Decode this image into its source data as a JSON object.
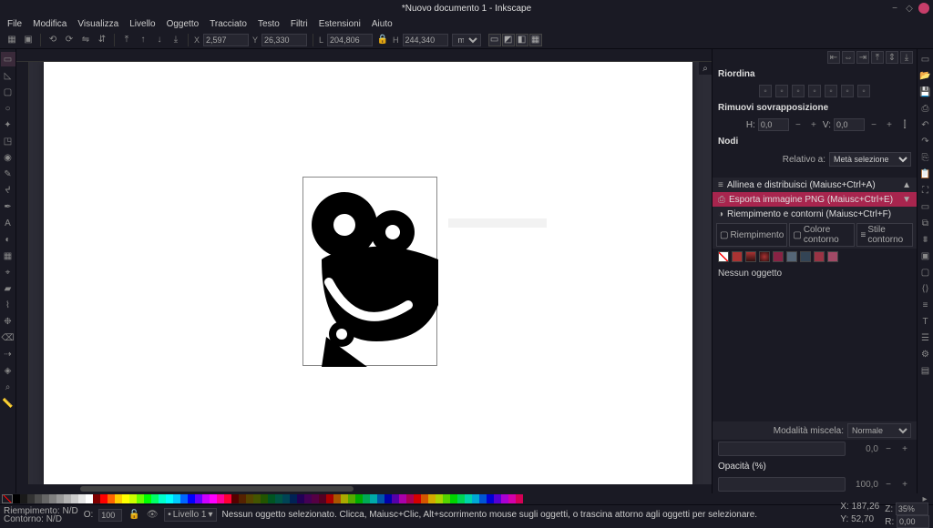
{
  "title": "*Nuovo documento 1 - Inkscape",
  "menu": [
    "File",
    "Modifica",
    "Visualizza",
    "Livello",
    "Oggetto",
    "Tracciato",
    "Testo",
    "Filtri",
    "Estensioni",
    "Aiuto"
  ],
  "toolbar": {
    "x_label": "X",
    "x_value": "2,597",
    "y_label": "Y",
    "y_value": "26,330",
    "w_label": "L",
    "w_value": "204,806",
    "h_label": "H",
    "h_value": "244,340",
    "unit": "mm"
  },
  "right": {
    "reorder": "Riordina",
    "overlap": "Rimuovi sovrapposizione",
    "hv_h": "H:",
    "hv_h_val": "0,0",
    "hv_v": "V:",
    "hv_v_val": "0,0",
    "nodes": "Nodi",
    "rel_label": "Relativo a:",
    "rel_value": "Metà selezione",
    "dock_align": "Allinea e distribuisci (Maiusc+Ctrl+A)",
    "dock_export": "Esporta immagine PNG (Maiusc+Ctrl+E)",
    "dock_fill": "Riempimento e contorni (Maiusc+Ctrl+F)",
    "fill_tab": "Riempimento",
    "stroke_tab": "Colore contorno",
    "style_tab": "Stile contorno",
    "none_obj": "Nessun oggetto",
    "blend_label": "Modalità miscela:",
    "blend_value": "Normale",
    "blur_val": "0,0",
    "opacity_label": "Opacità (%)",
    "opacity_val": "100,0"
  },
  "status": {
    "fill_label": "Riempimento:",
    "fill_val": "N/D",
    "stroke_label": "Contorno:",
    "stroke_val": "N/D",
    "opacity_short": "O:",
    "opacity_val": "100",
    "layer": "Livello 1",
    "msg": "Nessun oggetto selezionato. Clicca, Maiusc+Clic, Alt+scorrimento mouse sugli oggetti, o trascina attorno agli oggetti per selezionare.",
    "x_label": "X:",
    "x_val": "187,26",
    "y_label": "Y:",
    "y_val": "52,70",
    "z_label": "Z:",
    "z_val": "35%",
    "r_label": "R:",
    "r_val": "0,00"
  },
  "palette": [
    "#000000",
    "#1a1a1a",
    "#333333",
    "#4d4d4d",
    "#666666",
    "#808080",
    "#999999",
    "#b3b3b3",
    "#cccccc",
    "#e6e6e6",
    "#ffffff",
    "#800000",
    "#ff0000",
    "#ff6600",
    "#ffcc00",
    "#ffff00",
    "#ccff00",
    "#66ff00",
    "#00ff00",
    "#00ff66",
    "#00ffcc",
    "#00ffff",
    "#00ccff",
    "#0066ff",
    "#0000ff",
    "#6600ff",
    "#cc00ff",
    "#ff00ff",
    "#ff0099",
    "#ff0033",
    "#550000",
    "#552200",
    "#554400",
    "#445500",
    "#225500",
    "#005522",
    "#005544",
    "#004455",
    "#002255",
    "#220055",
    "#440055",
    "#550044",
    "#550022",
    "#aa0000",
    "#aa5500",
    "#aaaa00",
    "#55aa00",
    "#00aa00",
    "#00aa55",
    "#00aaaa",
    "#0055aa",
    "#0000aa",
    "#5500aa",
    "#aa00aa",
    "#aa0055",
    "#d40000",
    "#d45500",
    "#d4aa00",
    "#aad400",
    "#55d400",
    "#00d400",
    "#00d455",
    "#00d4aa",
    "#00aad4",
    "#0055d4",
    "#0000d4",
    "#5500d4",
    "#aa00d4",
    "#d400aa",
    "#d40055"
  ]
}
